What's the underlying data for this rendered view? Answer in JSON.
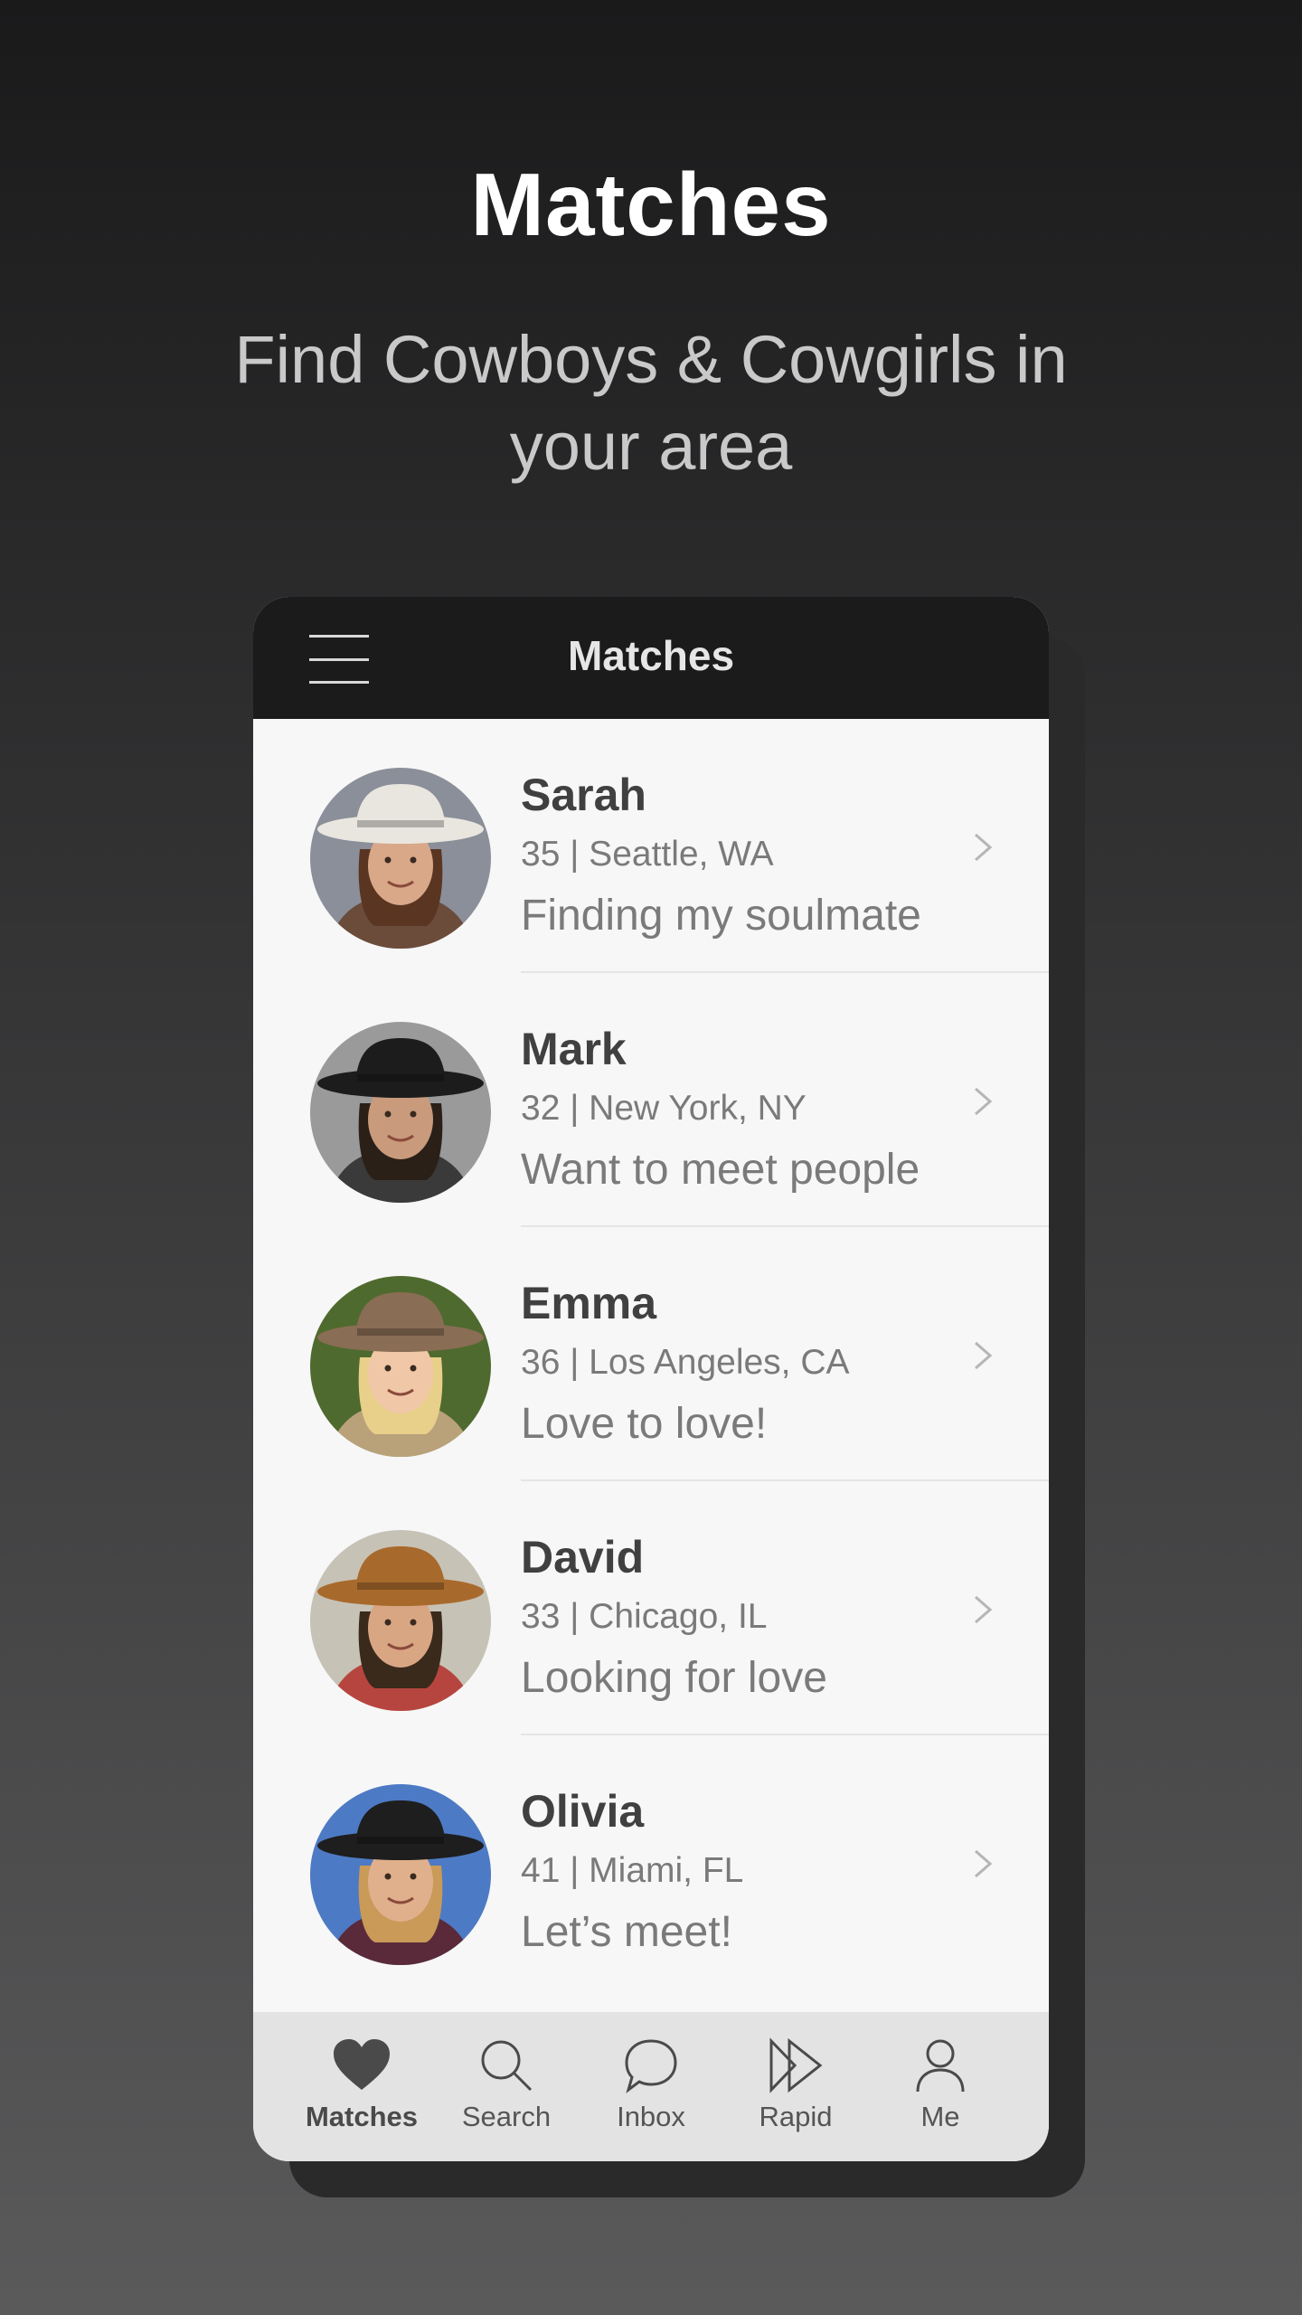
{
  "promo": {
    "title": "Matches",
    "subtitle": "Find Cowboys & Cowgirls in your area"
  },
  "app": {
    "header_title": "Matches",
    "menu_icon": "hamburger-menu-icon"
  },
  "matches": [
    {
      "name": "Sarah",
      "meta": "35 | Seattle, WA",
      "tagline": "Finding my soulmate",
      "hat": "#e9e6df",
      "hair": "#5a3522",
      "skin": "#d8a889",
      "bg": "#8a8f99",
      "shirt": "#6b4b3a"
    },
    {
      "name": "Mark",
      "meta": "32 | New York, NY",
      "tagline": "Want to meet people",
      "hat": "#1c1c1c",
      "hair": "#2a2018",
      "skin": "#c99a7c",
      "bg": "#9a9a9a",
      "shirt": "#3a3a3a"
    },
    {
      "name": "Emma",
      "meta": "36 | Los Angeles, CA",
      "tagline": "Love to love!",
      "hat": "#8a6d55",
      "hair": "#e8cf8a",
      "skin": "#f0c8a8",
      "bg": "#4f6a2e",
      "shirt": "#b9a27a"
    },
    {
      "name": "David",
      "meta": "33 | Chicago, IL",
      "tagline": "Looking for love",
      "hat": "#a86a2c",
      "hair": "#3a2a1c",
      "skin": "#d9a684",
      "bg": "#c7c2b6",
      "shirt": "#b7453f"
    },
    {
      "name": "Olivia",
      "meta": "41 | Miami, FL",
      "tagline": "Let’s meet!",
      "hat": "#1e1e1e",
      "hair": "#c99a58",
      "skin": "#e0b08c",
      "bg": "#4d7ac4",
      "shirt": "#5a2a3a"
    }
  ],
  "tabs": [
    {
      "label": "Matches",
      "icon": "heart-icon",
      "active": true
    },
    {
      "label": "Search",
      "icon": "search-icon",
      "active": false
    },
    {
      "label": "Inbox",
      "icon": "chat-bubble-icon",
      "active": false
    },
    {
      "label": "Rapid",
      "icon": "fast-forward-icon",
      "active": false
    },
    {
      "label": "Me",
      "icon": "user-icon",
      "active": false
    }
  ]
}
